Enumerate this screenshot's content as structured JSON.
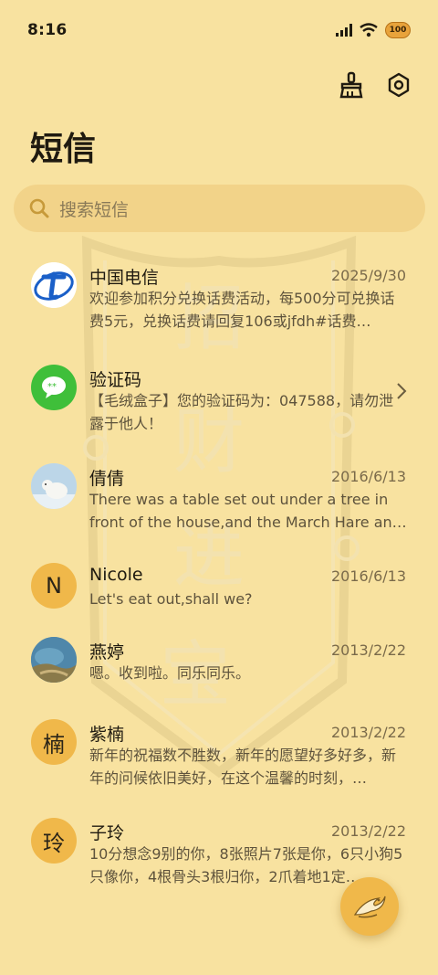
{
  "status": {
    "time": "8:16",
    "battery": "100",
    "icons": [
      "signal-icon",
      "wifi-icon",
      "battery-icon"
    ]
  },
  "header": {
    "title": "短信",
    "actions": [
      "clean-icon",
      "settings-icon"
    ]
  },
  "search": {
    "placeholder": "搜索短信"
  },
  "messages": [
    {
      "name": "中国电信",
      "date": "2025/9/30",
      "preview": "欢迎参加积分兑换话费活动，每500分可兑换话费5元，兑换话费请回复106或jfdh#话费…",
      "avatar": "china-telecom-logo"
    },
    {
      "name": "验证码",
      "date": "",
      "preview": "【毛绒盒子】您的验证码为：047588，请勿泄露于他人！",
      "avatar": "message-group-icon"
    },
    {
      "name": "倩倩",
      "date": "2016/6/13",
      "preview": "There was a table set out under a tree in front of the house,and the March Hare an…",
      "avatar": "polar-bear-photo"
    },
    {
      "name": "Nicole",
      "date": "2016/6/13",
      "preview": "Let's eat out,shall we?",
      "avatar_letter": "N"
    },
    {
      "name": "燕婷",
      "date": "2013/2/22",
      "preview": "嗯。收到啦。同乐同乐。",
      "avatar": "landscape-photo"
    },
    {
      "name": "紫楠",
      "date": "2013/2/22",
      "preview": "新年的祝福数不胜数，新年的愿望好多好多，新年的问候依旧美好，在这个温馨的时刻，…",
      "avatar_letter": "楠"
    },
    {
      "name": "子玲",
      "date": "2013/2/22",
      "preview": "10分想念9别的你，8张照片7张是你，6只小狗5只像你，4根骨头3根归你，2爪着地1定…",
      "avatar_letter": "玲"
    }
  ],
  "theme": {
    "background": "#f8e2a0",
    "accent": "#f0b84a",
    "telecom_blue": "#1a5fc8",
    "message_green": "#3fbf3a"
  },
  "watermark": {
    "text": [
      "招",
      "财",
      "进",
      "宝"
    ]
  },
  "fab": {
    "icon": "phoenix-compose-icon"
  }
}
